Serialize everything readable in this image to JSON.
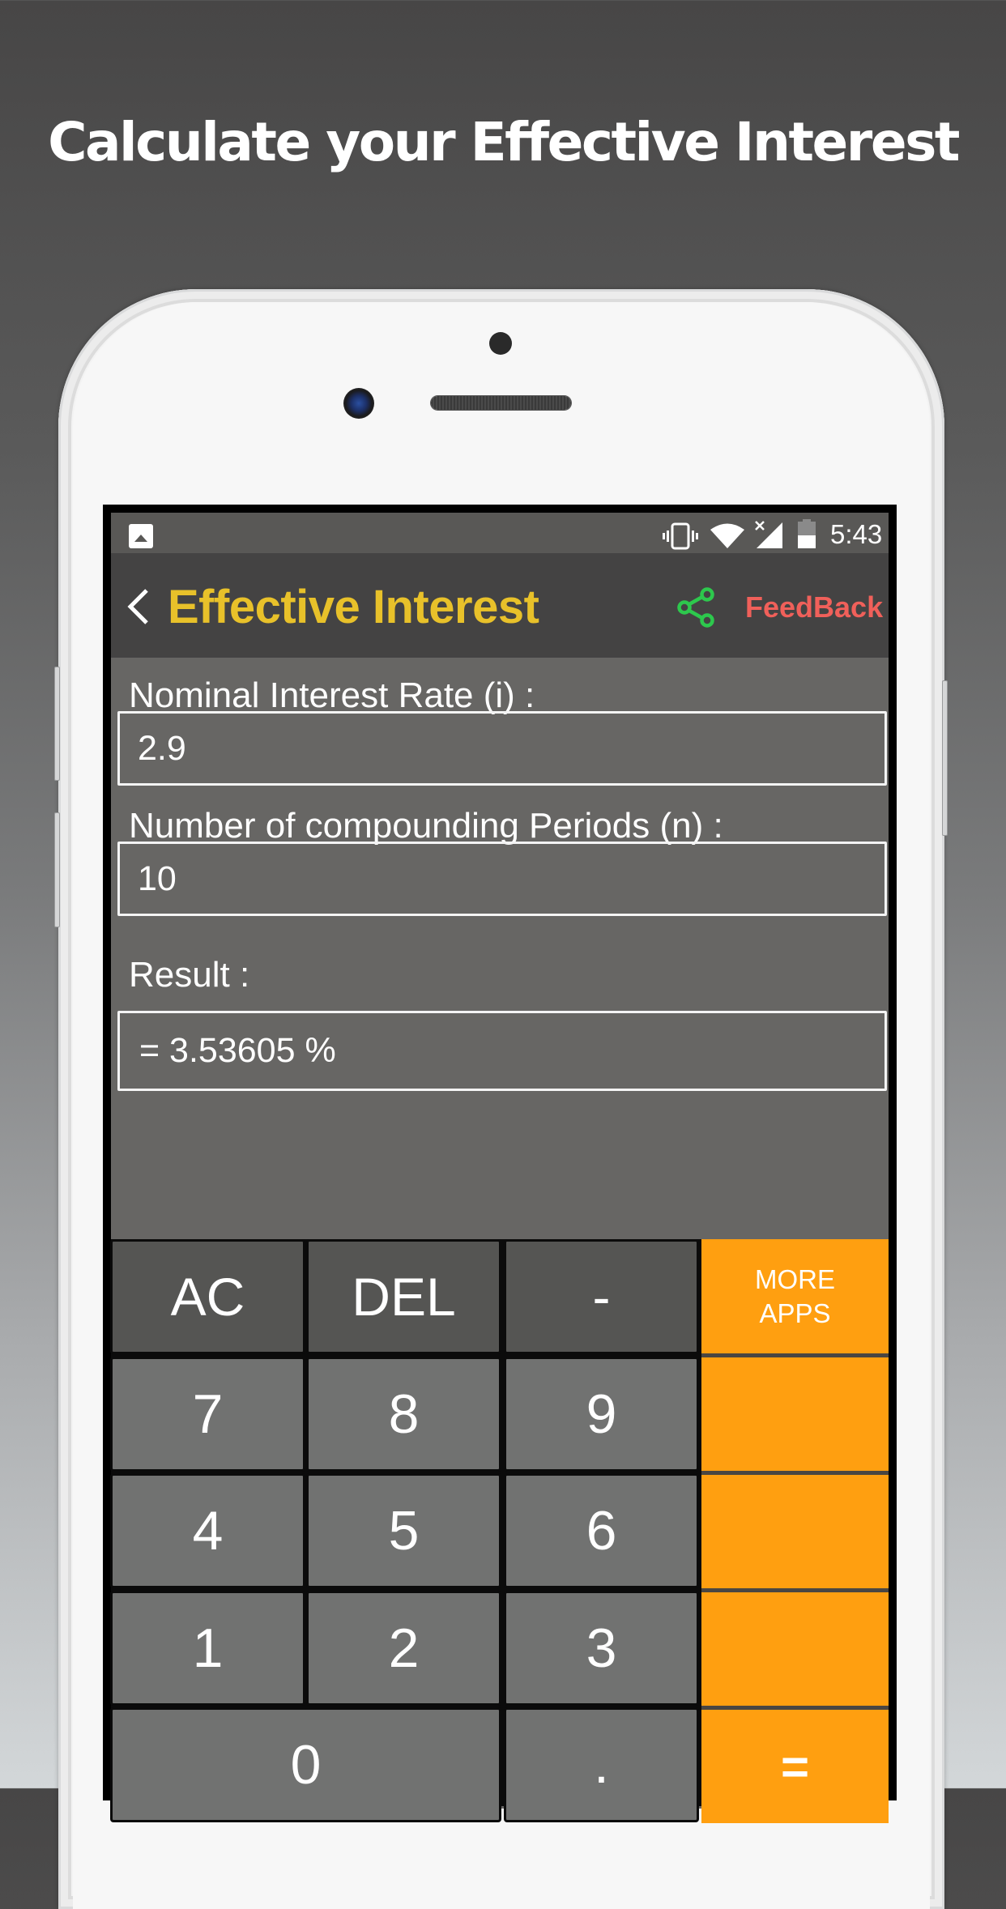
{
  "promo": {
    "headline": "Calculate your Effective Interest"
  },
  "status_bar": {
    "left_icons": [
      "gallery-notification-icon"
    ],
    "right_icons": [
      "vibrate-icon",
      "wifi-icon",
      "signal-no-sim-icon",
      "battery-icon"
    ],
    "time": "5:43",
    "battery_level_fraction": 0.5
  },
  "app_bar": {
    "back_icon": "chevron-left-icon",
    "title": "Effective Interest",
    "share_icon": "share-icon",
    "feedback_label": "FeedBack",
    "colors": {
      "title": "#E8C12A",
      "share": "#2DC84D",
      "feedback": "#F0605A"
    }
  },
  "form": {
    "nominal_rate": {
      "label": "Nominal Interest Rate (i) :",
      "value": "2.9"
    },
    "periods": {
      "label": "Number of compounding Periods (n) :",
      "value": "10"
    },
    "result": {
      "label": "Result :",
      "value": "= 3.53605 %"
    }
  },
  "keypad": {
    "accent_color": "#FF9F10",
    "rows": [
      [
        {
          "label": "AC",
          "type": "dark"
        },
        {
          "label": "DEL",
          "type": "dark"
        },
        {
          "label": "-",
          "type": "dark"
        },
        {
          "label": "MORE\nAPPS",
          "type": "orange"
        }
      ],
      [
        {
          "label": "7",
          "type": "num"
        },
        {
          "label": "8",
          "type": "num"
        },
        {
          "label": "9",
          "type": "num"
        },
        {
          "label": "",
          "type": "orange"
        }
      ],
      [
        {
          "label": "4",
          "type": "num"
        },
        {
          "label": "5",
          "type": "num"
        },
        {
          "label": "6",
          "type": "num"
        },
        {
          "label": "",
          "type": "orange"
        }
      ],
      [
        {
          "label": "1",
          "type": "num"
        },
        {
          "label": "2",
          "type": "num"
        },
        {
          "label": "3",
          "type": "num"
        },
        {
          "label": "",
          "type": "orange"
        }
      ],
      [
        {
          "label": "0",
          "type": "num"
        },
        {
          "label": ".",
          "type": "num"
        },
        {
          "label": "=",
          "type": "orange"
        }
      ]
    ],
    "more_apps_line1": "MORE",
    "more_apps_line2": "APPS"
  }
}
